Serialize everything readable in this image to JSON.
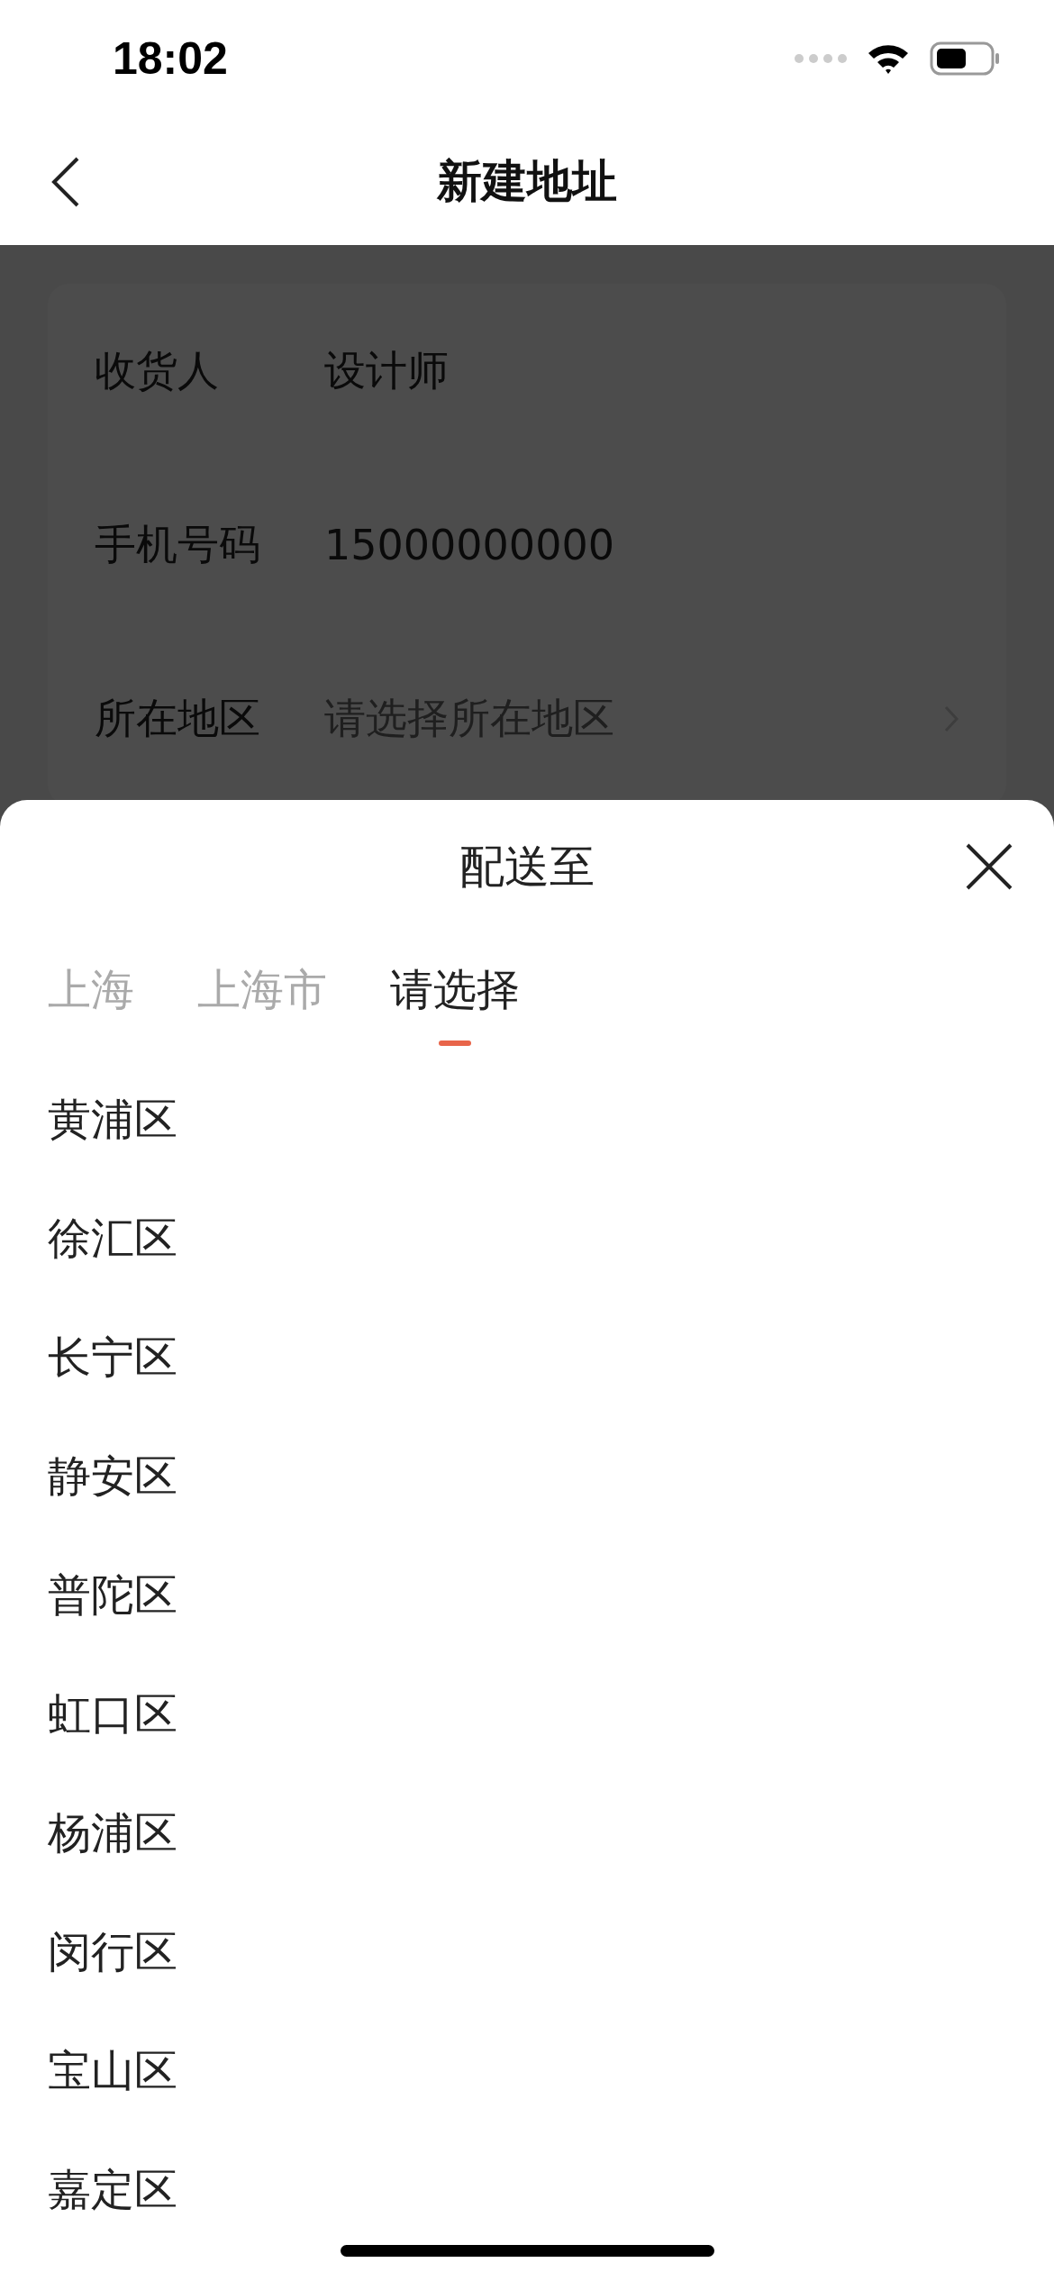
{
  "status_bar": {
    "time": "18:02"
  },
  "nav": {
    "title": "新建地址"
  },
  "form": {
    "rows": [
      {
        "label": "收货人",
        "value": "设计师",
        "kind": "text"
      },
      {
        "label": "手机号码",
        "value": "15000000000",
        "kind": "text"
      },
      {
        "label": "所在地区",
        "placeholder": "请选择所在地区",
        "kind": "select"
      }
    ]
  },
  "sheet": {
    "title": "配送至",
    "tabs": [
      {
        "label": "上海",
        "selected": false
      },
      {
        "label": "上海市",
        "selected": false
      },
      {
        "label": "请选择",
        "selected": true
      }
    ],
    "items": [
      "黄浦区",
      "徐汇区",
      "长宁区",
      "静安区",
      "普陀区",
      "虹口区",
      "杨浦区",
      "闵行区",
      "宝山区",
      "嘉定区"
    ]
  }
}
